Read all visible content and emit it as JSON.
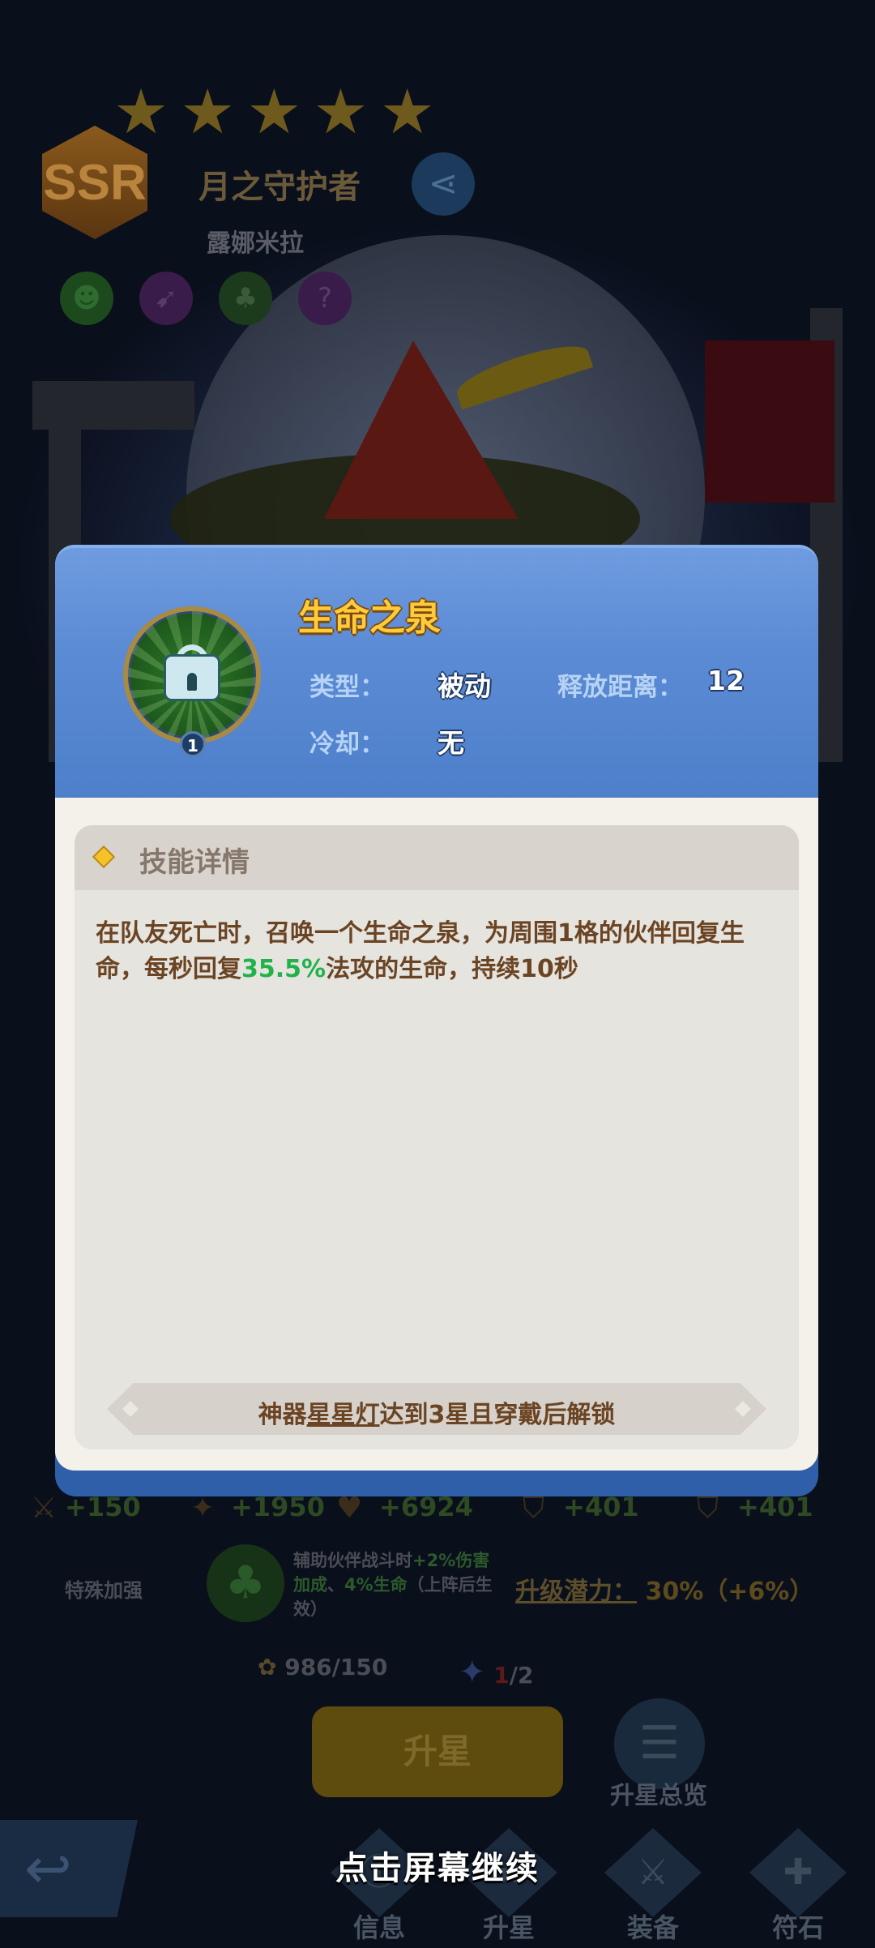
{
  "hero": {
    "rarity": "SSR",
    "stars": 5,
    "title": "月之守护者",
    "name": "露娜米拉",
    "traits": [
      "green-ghost-icon",
      "bow-icon",
      "tree-icon",
      "question-icon"
    ]
  },
  "skill_popup": {
    "name": "生命之泉",
    "level": "1",
    "type_label": "类型：",
    "type_value": "被动",
    "range_label": "释放距离：",
    "range_value": "12",
    "cooldown_label": "冷却：",
    "cooldown_value": "无",
    "detail_title": "技能详情",
    "description_before": "在队友死亡时，召唤一个生命之泉，为周围1格的伙伴回复生命，每秒回复",
    "description_highlight": "35.5%",
    "description_after": "法攻的生命，持续10秒",
    "unlock_prefix": "神器",
    "unlock_item": "星星灯",
    "unlock_suffix": "达到3星且穿戴后解锁",
    "highlight_color": "#22b24a"
  },
  "stats": [
    "+150",
    "+1950",
    "+6924",
    "+401",
    "+401"
  ],
  "special_bonus": {
    "label": "特殊加强",
    "desc_prefix": "辅助伙伴战斗时",
    "desc_hl1": "+2%伤害加成",
    "desc_mid": "、",
    "desc_hl2": "4%生命",
    "desc_suffix": "（上阵后生效）",
    "potential_label": "升级潜力：",
    "potential_value": "30%（+6%）"
  },
  "materials": {
    "shards": "986/150",
    "star_have": "1",
    "star_need": "/2"
  },
  "buttons": {
    "star_up": "升星",
    "overview": "升星总览",
    "continue_hint": "点击屏幕继续"
  },
  "tabs": [
    "信息",
    "升星",
    "装备",
    "符石"
  ]
}
